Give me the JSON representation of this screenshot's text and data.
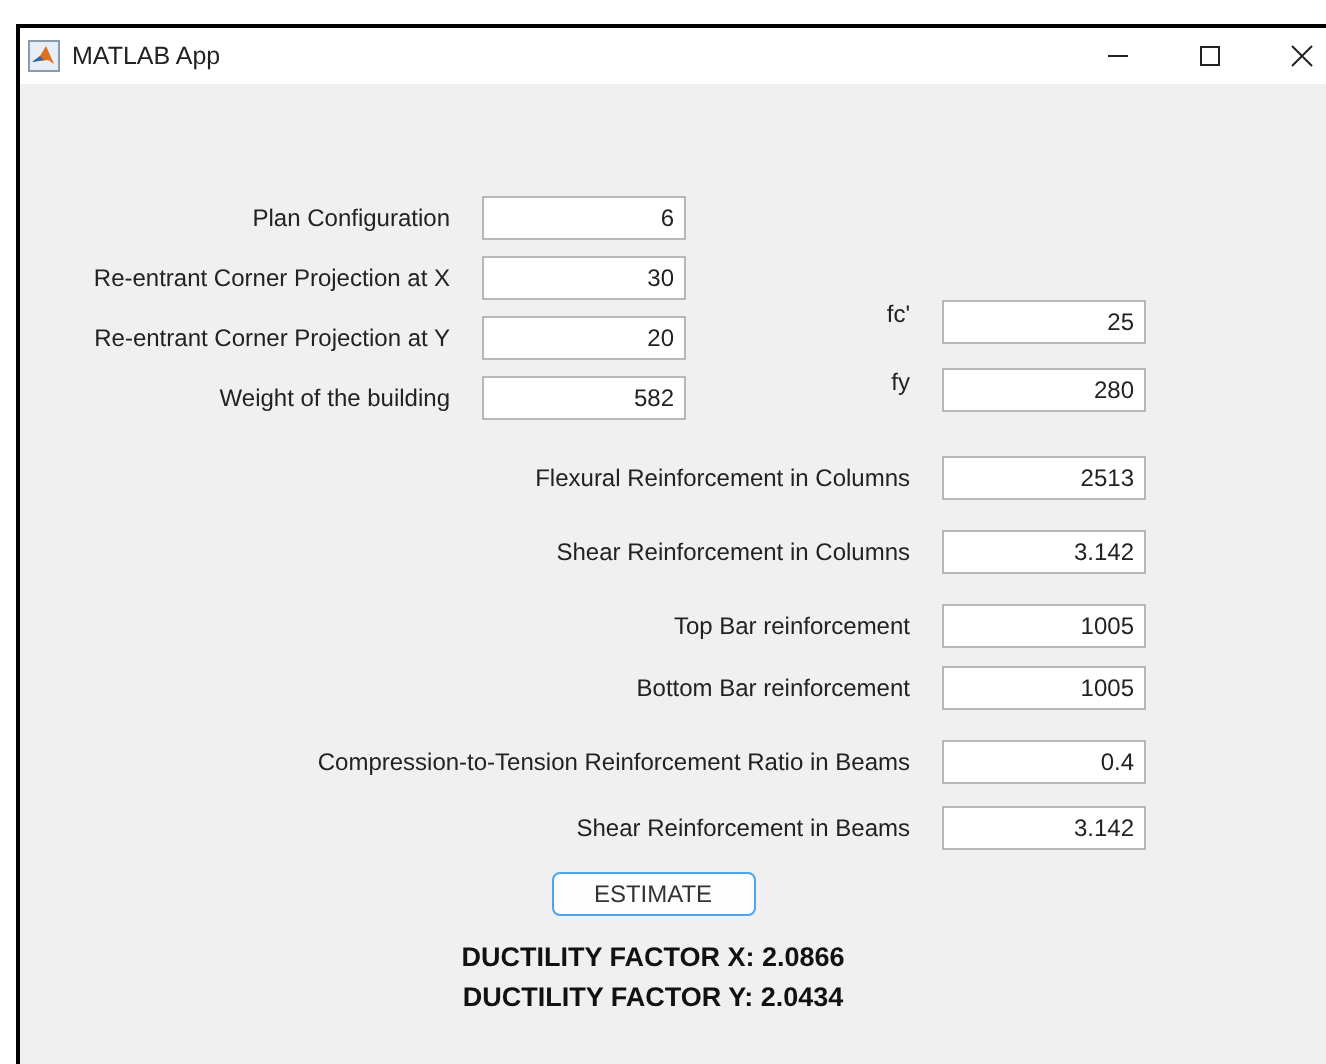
{
  "window": {
    "title": "MATLAB App"
  },
  "top_left_fields": [
    {
      "label": "Plan Configuration",
      "value": "6"
    },
    {
      "label": "Re-entrant Corner Projection at X",
      "value": "30"
    },
    {
      "label": "Re-entrant Corner Projection at Y",
      "value": "20"
    },
    {
      "label": "Weight of the building",
      "value": "582"
    }
  ],
  "top_right_fields": [
    {
      "label": "fc'",
      "value": "25"
    },
    {
      "label": "fy",
      "value": "280"
    }
  ],
  "fields": [
    {
      "label": "Flexural Reinforcement in Columns",
      "value": "2513"
    },
    {
      "label": "Shear Reinforcement in Columns",
      "value": "3.142"
    },
    {
      "label": "Top Bar reinforcement",
      "value": "1005"
    },
    {
      "label": "Bottom Bar reinforcement",
      "value": "1005"
    },
    {
      "label": "Compression-to-Tension Reinforcement Ratio in Beams",
      "value": "0.4"
    },
    {
      "label": "Shear Reinforcement in Beams",
      "value": "3.142"
    }
  ],
  "estimate_button": "ESTIMATE",
  "results": [
    "DUCTILITY FACTOR X: 2.0866",
    "DUCTILITY FACTOR Y: 2.0434"
  ]
}
